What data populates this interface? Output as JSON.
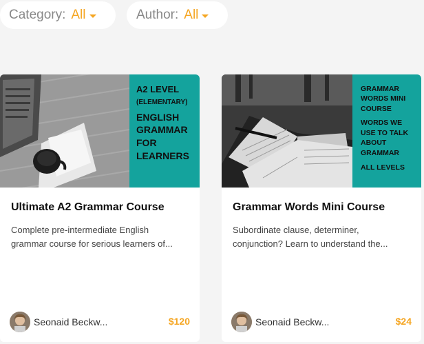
{
  "filters": {
    "category": {
      "label": "Category:",
      "value": "All"
    },
    "author": {
      "label": "Author:",
      "value": "All"
    }
  },
  "colors": {
    "accent": "#f5a623",
    "banner": "#14a39d"
  },
  "courses": [
    {
      "banner": {
        "line1": "A2 LEVEL",
        "line2": "(ELEMENTARY)",
        "line3": "ENGLISH",
        "line4": "GRAMMAR",
        "line5": "FOR",
        "line6": "LEARNERS"
      },
      "title": "Ultimate A2 Grammar Course",
      "description_line1": "Complete pre-intermediate English",
      "description_line2": "grammar course for serious learners of...",
      "author": "Seonaid Beckw...",
      "price": "$120"
    },
    {
      "banner": {
        "line1": "GRAMMAR",
        "line2": "WORDS MINI",
        "line3": "COURSE",
        "line4": "WORDS WE",
        "line5": "USE TO TALK",
        "line6": "ABOUT",
        "line7": "GRAMMAR",
        "line8": "ALL LEVELS"
      },
      "title": "Grammar Words Mini Course",
      "description_line1": "Subordinate clause, determiner,",
      "description_line2": "conjunction? Learn to understand the...",
      "author": "Seonaid Beckw...",
      "price": "$24"
    }
  ]
}
